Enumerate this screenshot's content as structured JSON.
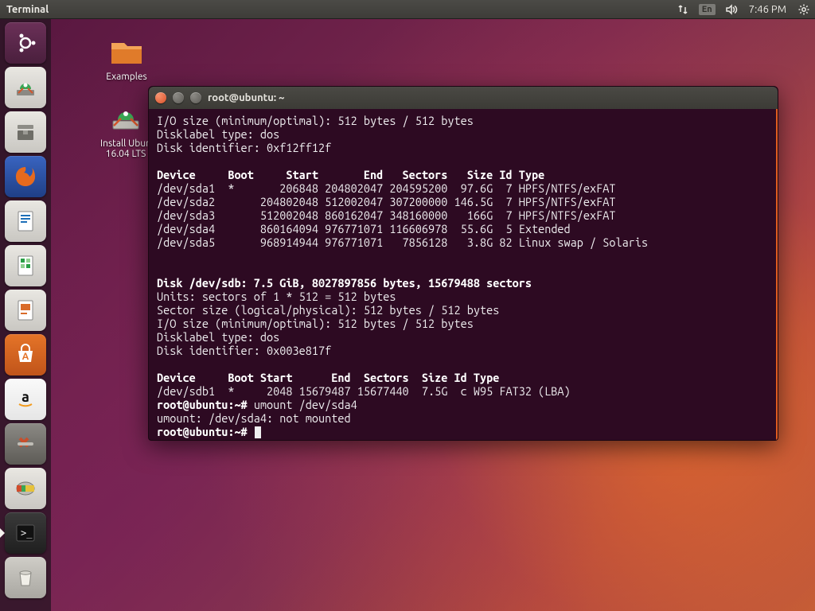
{
  "menubar": {
    "app_title": "Terminal",
    "lang": "En",
    "clock": "7:46 PM"
  },
  "desktop": {
    "examples_label": "Examples",
    "install_label_1": "Install Ubun",
    "install_label_2": "16.04 LTS"
  },
  "launcher": {
    "items": [
      {
        "name": "dash-icon"
      },
      {
        "name": "ubiquity-icon"
      },
      {
        "name": "files-icon"
      },
      {
        "name": "firefox-icon"
      },
      {
        "name": "writer-icon"
      },
      {
        "name": "calc-icon"
      },
      {
        "name": "impress-icon"
      },
      {
        "name": "software-icon"
      },
      {
        "name": "amazon-icon"
      },
      {
        "name": "settings-icon"
      },
      {
        "name": "gparted-icon"
      },
      {
        "name": "terminal-icon"
      },
      {
        "name": "trash-icon"
      }
    ]
  },
  "terminal": {
    "window_title": "root@ubuntu: ~",
    "fdisk_sda": {
      "io_size": "I/O size (minimum/optimal): 512 bytes / 512 bytes",
      "dlabel": "Disklabel type: dos",
      "dident": "Disk identifier: 0xf12ff12f",
      "header": "Device     Boot     Start       End   Sectors   Size Id Type",
      "rows": [
        "/dev/sda1  *       206848 204802047 204595200  97.6G  7 HPFS/NTFS/exFAT",
        "/dev/sda2       204802048 512002047 307200000 146.5G  7 HPFS/NTFS/exFAT",
        "/dev/sda3       512002048 860162047 348160000   166G  7 HPFS/NTFS/exFAT",
        "/dev/sda4       860164094 976771071 116606978  55.6G  5 Extended",
        "/dev/sda5       968914944 976771071   7856128   3.8G 82 Linux swap / Solaris"
      ]
    },
    "fdisk_sdb": {
      "header_line": "Disk /dev/sdb: 7.5 GiB, 8027897856 bytes, 15679488 sectors",
      "units": "Units: sectors of 1 * 512 = 512 bytes",
      "sector": "Sector size (logical/physical): 512 bytes / 512 bytes",
      "io_size": "I/O size (minimum/optimal): 512 bytes / 512 bytes",
      "dlabel": "Disklabel type: dos",
      "dident": "Disk identifier: 0x003e817f",
      "header": "Device     Boot Start      End  Sectors  Size Id Type",
      "row": "/dev/sdb1  *     2048 15679487 15677440  7.5G  c W95 FAT32 (LBA)"
    },
    "session": {
      "prompt": "root@ubuntu:~#",
      "cmd1": "umount /dev/sda4",
      "resp1": "umount: /dev/sda4: not mounted"
    }
  }
}
